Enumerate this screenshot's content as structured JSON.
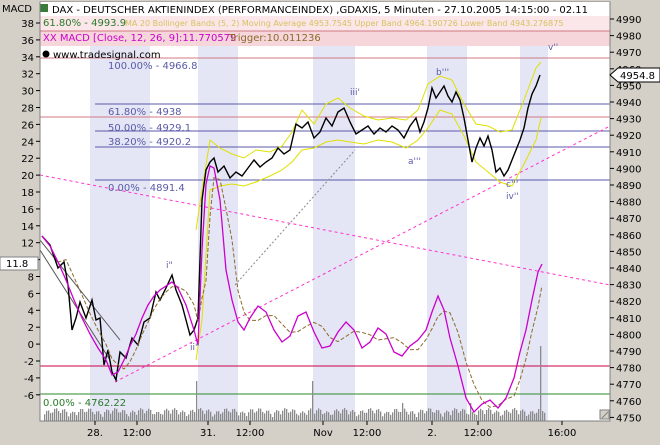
{
  "window": {
    "side_label": "MACD",
    "header_title": "DAX - DEUTSCHER AKTIENINDEX (PERFORMANCEINDEX) ,GDAXIS, 5 Minuten - 27.10.2005 14:15:00 - 02.11",
    "header_line2": "61.80% - 4993.9",
    "header_faded": "MA 20 Bollinger Bands (5, 2) Moving Average 4953.7545 Upper Band 4964.190726 Lower Band 4943.276875",
    "macd_legend": "XX MACD [Close, 12, 26, 9]:11.770579",
    "trigger_legend": "Trigger:10.011236",
    "watermark": "www.tradesignal.com"
  },
  "fib": {
    "f100": "100.00% - 4966.8",
    "f618": "61.80% - 4938",
    "f500": "50.00% - 4929.1",
    "f382": "38.20% - 4920.2",
    "f0": "0.00% - 4891.4",
    "fbottom": "0.00% - 4762.22"
  },
  "wave_labels": {
    "i": "i\"",
    "ii": "ii\"",
    "iii": "iii'",
    "a": "a'''",
    "b": "b'''",
    "c": "c'''",
    "iv": "iv''",
    "v": "v''"
  },
  "price_label": "4954.8",
  "macd_marker": "11.8",
  "left_axis": [
    "38",
    "36",
    "34",
    "32",
    "30",
    "28",
    "26",
    "24",
    "22",
    "20",
    "18",
    "16",
    "14",
    "12",
    "10",
    "8",
    "6",
    "4",
    "2",
    "0",
    "-2",
    "-4",
    "-6"
  ],
  "right_axis": [
    "4990",
    "4980",
    "4970",
    "4960",
    "4950",
    "4940",
    "4930",
    "4920",
    "4910",
    "4900",
    "4890",
    "4880",
    "4870",
    "4860",
    "4850",
    "4840",
    "4830",
    "4820",
    "4810",
    "4800",
    "4790",
    "4780",
    "4770",
    "4760",
    "4750"
  ],
  "x_axis": [
    "28.",
    "12:00",
    "31.",
    "12:00",
    "Nov",
    "12:00",
    "2.",
    "12:00",
    "16:00"
  ],
  "colors": {
    "price": "#000000",
    "bollinger": "#e0e000",
    "macd": "#cc00cc",
    "trigger": "#8b6b2b",
    "session": "#e4e6f6",
    "fib": "#5a5aa8",
    "trend": "#ff33cc"
  }
}
